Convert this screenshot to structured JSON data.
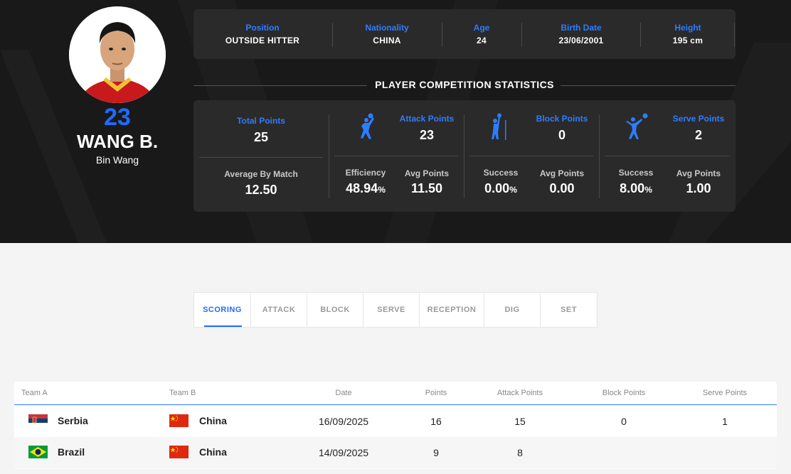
{
  "player": {
    "number": "23",
    "name": "WANG B.",
    "full_name": "Bin Wang"
  },
  "info": [
    {
      "label": "Position",
      "value": "OUTSIDE HITTER"
    },
    {
      "label": "Nationality",
      "value": "CHINA"
    },
    {
      "label": "Age",
      "value": "24"
    },
    {
      "label": "Birth Date",
      "value": "23/06/2001"
    },
    {
      "label": "Height",
      "value": "195 cm"
    }
  ],
  "stats_title": "PLAYER COMPETITION STATISTICS",
  "stats": {
    "total": {
      "label": "Total Points",
      "value": "25",
      "avg_label": "Average By Match",
      "avg_value": "12.50"
    },
    "attack": {
      "label": "Attack Points",
      "value": "23",
      "rate_label": "Efficiency",
      "rate_value": "48.94",
      "avg_label": "Avg Points",
      "avg_value": "11.50"
    },
    "block": {
      "label": "Block Points",
      "value": "0",
      "rate_label": "Success",
      "rate_value": "0.00",
      "avg_label": "Avg Points",
      "avg_value": "0.00"
    },
    "serve": {
      "label": "Serve Points",
      "value": "2",
      "rate_label": "Success",
      "rate_value": "8.00",
      "avg_label": "Avg Points",
      "avg_value": "1.00"
    },
    "pct": "%"
  },
  "tabs": [
    "SCORING",
    "ATTACK",
    "BLOCK",
    "SERVE",
    "RECEPTION",
    "DIG",
    "SET"
  ],
  "table": {
    "headers": [
      "Team A",
      "Team B",
      "Date",
      "Points",
      "Attack Points",
      "Block Points",
      "Serve Points"
    ],
    "rows": [
      {
        "team_a": "Serbia",
        "team_b": "China",
        "date": "16/09/2025",
        "points": "16",
        "attack": "15",
        "block": "0",
        "serve": "1"
      },
      {
        "team_a": "Brazil",
        "team_b": "China",
        "date": "14/09/2025",
        "points": "9",
        "attack": "8",
        "block": "",
        "serve": ""
      }
    ]
  },
  "colors": {
    "accent": "#1f6bff",
    "hero_bg": "#191919",
    "card_bg": "#2a2a2a"
  }
}
